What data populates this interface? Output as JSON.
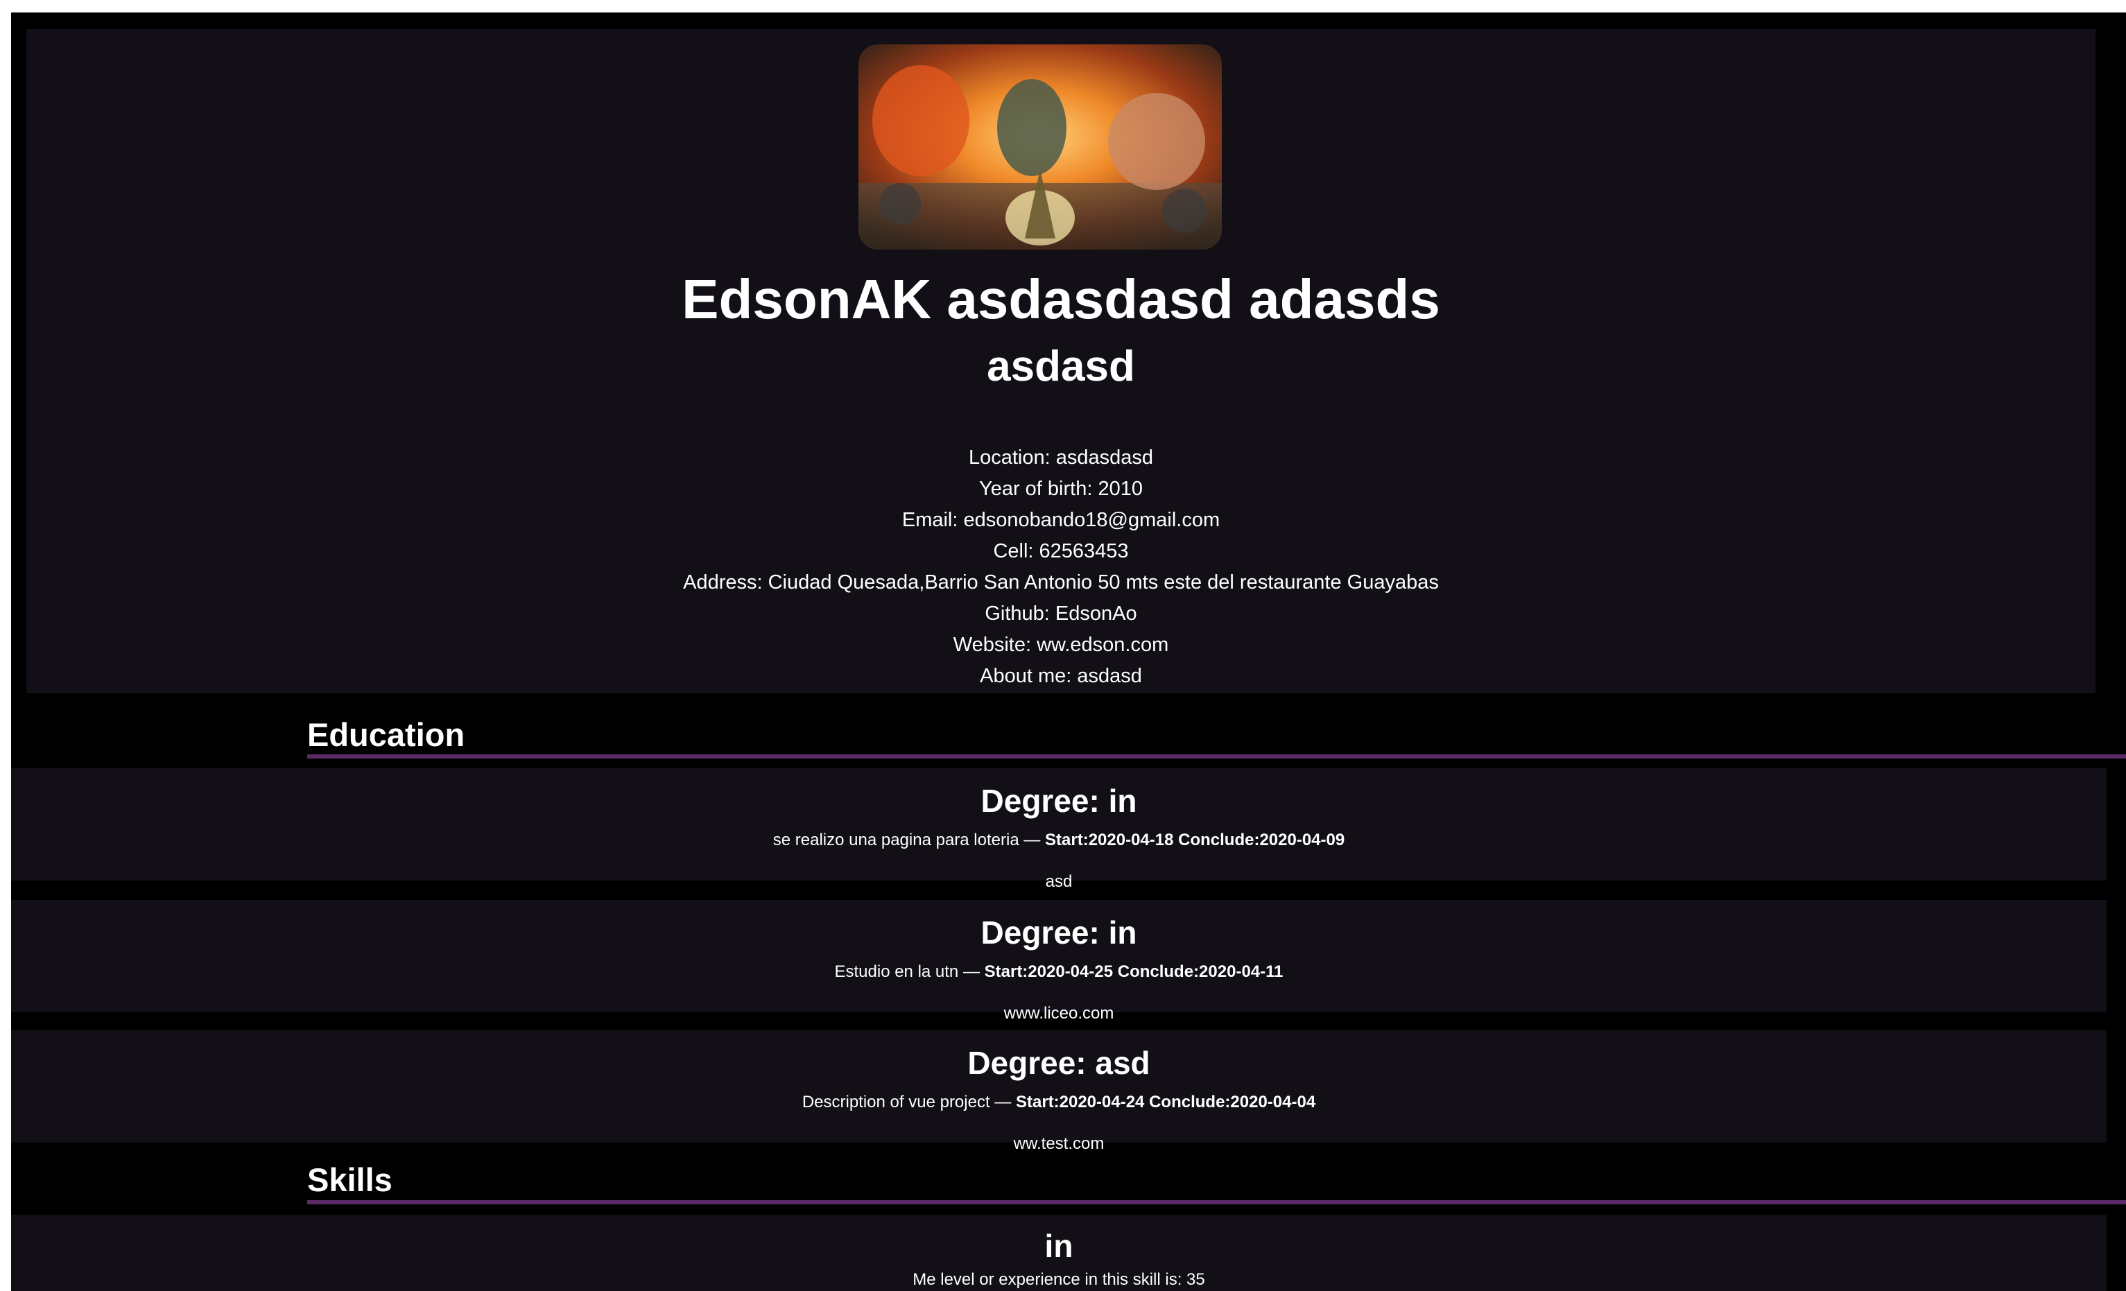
{
  "profile": {
    "name": "EdsonAK asdasdasd adasds",
    "title": "asdasd",
    "details": [
      {
        "label": "Location:",
        "value": "asdasdasd"
      },
      {
        "label": "Year of birth:",
        "value": "2010"
      },
      {
        "label": "Email:",
        "value": "edsonobando18@gmail.com"
      },
      {
        "label": "Cell:",
        "value": "62563453"
      },
      {
        "label": "Address:",
        "value": "Ciudad Quesada,Barrio San Antonio 50 mts este del restaurante Guayabas"
      },
      {
        "label": "Github:",
        "value": "EdsonAo"
      },
      {
        "label": "Website:",
        "value": "ww.edson.com"
      },
      {
        "label": "About me:",
        "value": "asdasd"
      }
    ]
  },
  "education": {
    "heading": "Education",
    "items": [
      {
        "degree": "Degree: in",
        "description": "se realizo una pagina para loteria",
        "dates": "Start:2020-04-18 Conclude:2020-04-09",
        "link": "asd"
      },
      {
        "degree": "Degree: in",
        "description": "Estudio en la utn",
        "dates": "Start:2020-04-25 Conclude:2020-04-11",
        "link": "www.liceo.com"
      },
      {
        "degree": "Degree: asd",
        "description": "Description of vue project",
        "dates": "Start:2020-04-24 Conclude:2020-04-04",
        "link": "ww.test.com"
      }
    ]
  },
  "skills": {
    "heading": "Skills",
    "items": [
      {
        "name": "in",
        "level_text": "Me level or experience in this skill is: 35"
      }
    ]
  },
  "colors": {
    "background": "#000000",
    "card": "#130f17",
    "accent_rule": "#5c2a66",
    "text": "#ffffff"
  }
}
